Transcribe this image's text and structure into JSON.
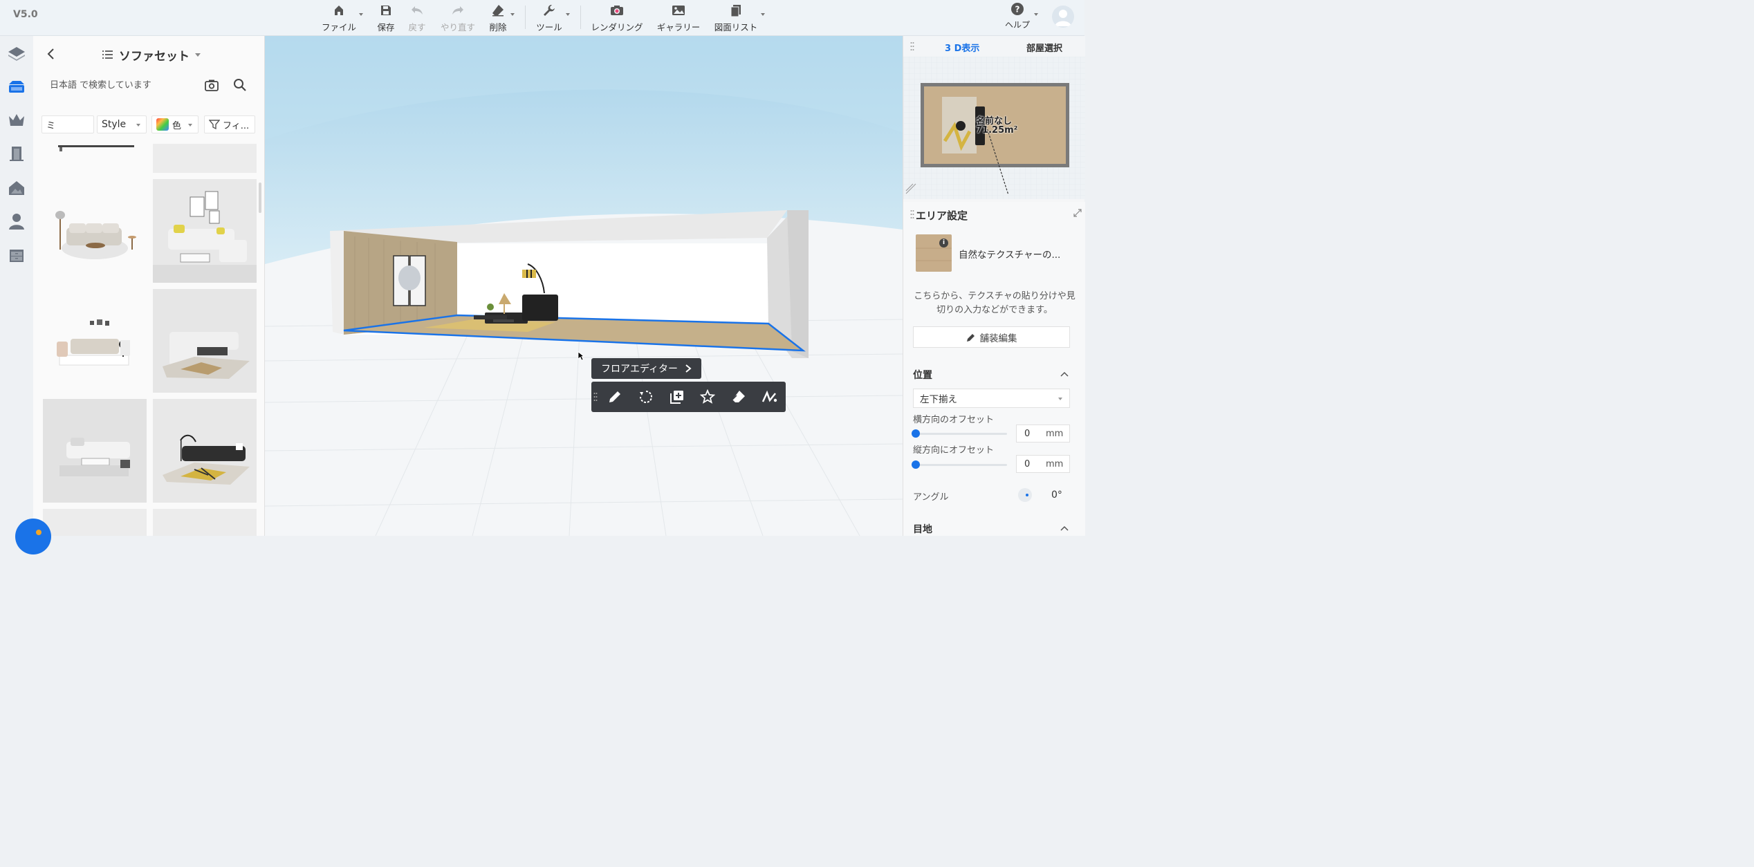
{
  "app": {
    "version": "V5.0"
  },
  "toolbar": {
    "file": "ファイル",
    "save": "保存",
    "undo": "戻す",
    "redo": "やり直す",
    "delete": "削除",
    "tools": "ツール",
    "rendering": "レンダリング",
    "gallery": "ギャラリー",
    "drawing_list": "図面リスト",
    "help": "ヘルプ"
  },
  "catalog": {
    "title": "ソファセット",
    "search_placeholder": "日本語 で検索しています",
    "filters": {
      "sort": "ミ",
      "style": "Style",
      "color": "色",
      "filter": "フィ..."
    }
  },
  "viewport": {
    "floor_editor_label": "フロアエディター"
  },
  "minimap": {
    "tab_3d": "3 D表示",
    "tab_room": "部屋選択",
    "room_name": "名前なし",
    "room_area": "71.25m²"
  },
  "area_settings": {
    "title": "エリア設定",
    "material_name": "自然なテクスチャーの...",
    "description": "こちらから、テクスチャの貼り分けや見切りの入力などができます。",
    "paving_button": "舗装編集",
    "position_heading": "位置",
    "alignment_value": "左下揃え",
    "h_offset_label": "横方向のオフセット",
    "h_offset_value": "0",
    "v_offset_label": "縦方向にオフセット",
    "v_offset_value": "0",
    "unit": "mm",
    "angle_label": "アングル",
    "angle_value": "0°",
    "joint_heading": "目地"
  },
  "colors": {
    "accent": "#1a73e8",
    "toolbar_bg": "#eef3f7",
    "dark_popup": "#3a3d42"
  }
}
